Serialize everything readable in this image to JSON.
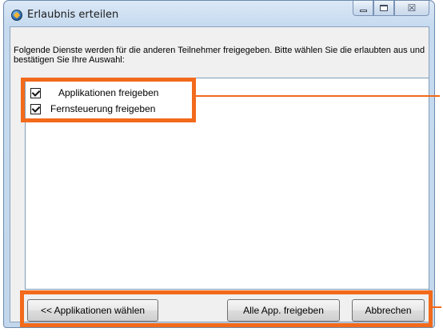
{
  "window": {
    "title": "Erlaubnis erteilen",
    "icon": "app-icon",
    "controls": {
      "minimize_icon": "minimize-icon",
      "maximize_icon": "maximize-icon",
      "close_glyph": "☒"
    }
  },
  "instruction": "Folgende Dienste werden für die anderen Teilnehmer freigegeben. Bitte wählen Sie die erlaubten aus und bestätigen Sie Ihre Auswahl:",
  "services": [
    {
      "label": "Applikationen freigeben",
      "checked": true
    },
    {
      "label": "Fernsteuerung freigeben",
      "checked": true
    }
  ],
  "buttons": {
    "back": "<< Applikationen wählen",
    "share_all": "Alle App. freigeben",
    "cancel": "Abbrechen"
  },
  "colors": {
    "highlight": "#f26a1b",
    "window_frame": "#c7dbf0",
    "client_bg": "#f0f0f0"
  }
}
